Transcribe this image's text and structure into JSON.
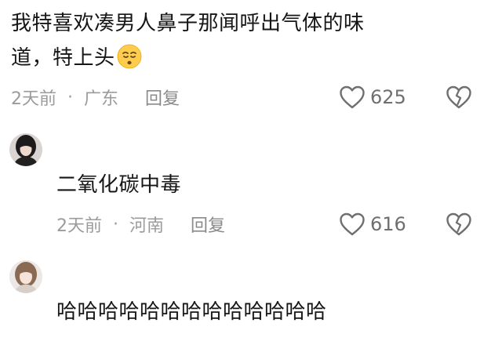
{
  "comments": [
    {
      "line1": "我特喜欢凑男人鼻子那闻呼出气体的味",
      "line2": "道，特上头",
      "emoji": "sleepy-face-emoji",
      "time": "2天前",
      "location": "广东",
      "reply_label": "回复",
      "likes": "625"
    },
    {
      "username": "",
      "text": "二氧化碳中毒",
      "time": "2天前",
      "location": "河南",
      "reply_label": "回复",
      "likes": "616"
    },
    {
      "username": "",
      "text": "哈哈哈哈哈哈哈哈哈哈哈哈哈"
    }
  ],
  "separator": "·",
  "colors": {
    "text": "#161616",
    "meta": "#9b9b9b",
    "icon": "#6f6f6f"
  }
}
